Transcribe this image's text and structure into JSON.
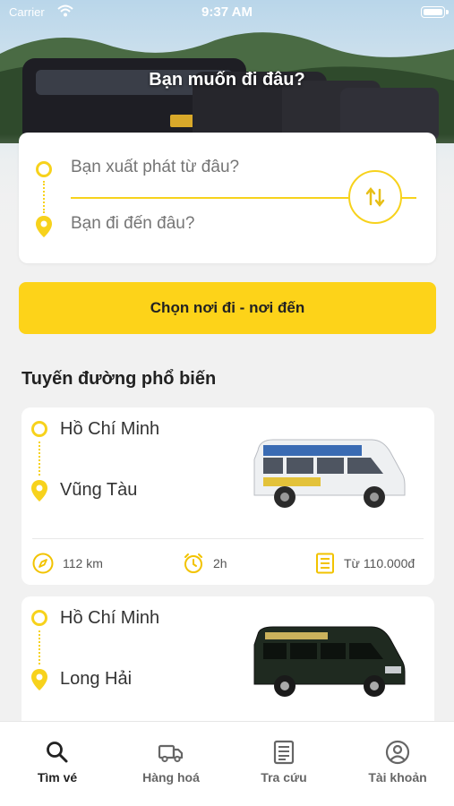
{
  "status_bar": {
    "carrier": "Carrier",
    "time": "9:37 AM"
  },
  "hero": {
    "headline": "Bạn muốn đi đâu?"
  },
  "search": {
    "from_placeholder": "Bạn xuất phát từ đâu?",
    "to_placeholder": "Bạn đi đến đâu?"
  },
  "cta": {
    "label": "Chọn nơi đi - nơi đến"
  },
  "popular": {
    "title": "Tuyến đường phổ biến",
    "routes": [
      {
        "from": "Hồ Chí Minh",
        "to": "Vũng Tàu",
        "distance": "112 km",
        "duration": "2h",
        "price": "Từ 110.000đ"
      },
      {
        "from": "Hồ Chí Minh",
        "to": "Long Hải"
      }
    ]
  },
  "tabs": [
    {
      "label": "Tìm vé",
      "icon": "search-icon",
      "active": true
    },
    {
      "label": "Hàng hoá",
      "icon": "truck-icon",
      "active": false
    },
    {
      "label": "Tra cứu",
      "icon": "document-icon",
      "active": false
    },
    {
      "label": "Tài khoản",
      "icon": "user-icon",
      "active": false
    }
  ],
  "colors": {
    "accent": "#fdd319",
    "accent_line": "#f7d21c"
  }
}
